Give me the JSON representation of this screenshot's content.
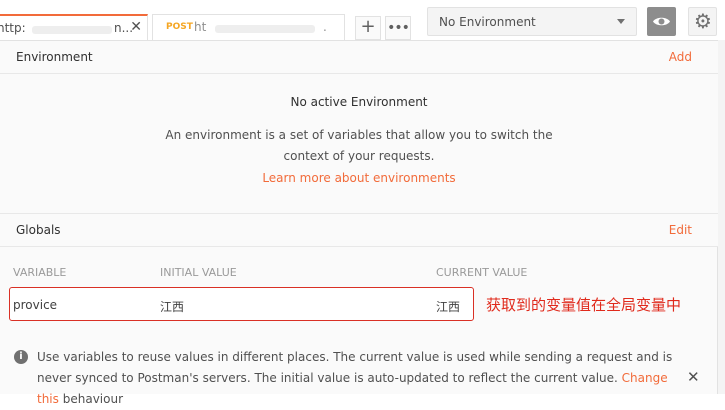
{
  "tabs": [
    {
      "method": "",
      "url": "http:",
      "suffix": "n...",
      "close": "✕"
    },
    {
      "method": "POST",
      "url": "ht",
      "suffix": "."
    }
  ],
  "toolbar": {
    "new_tab": "+",
    "more": "•••"
  },
  "environment_select": {
    "selected": "No Environment"
  },
  "environment_section": {
    "title": "Environment",
    "action": "Add",
    "empty_title": "No active Environment",
    "empty_desc_line1": "An environment is a set of variables that allow you to switch the",
    "empty_desc_line2": "context of your requests.",
    "learn_more": "Learn more about environments"
  },
  "globals_section": {
    "title": "Globals",
    "action": "Edit",
    "columns": [
      "VARIABLE",
      "INITIAL VALUE",
      "CURRENT VALUE"
    ],
    "rows": [
      {
        "variable": "provice",
        "initial_value": "江西",
        "current_value": "江西"
      }
    ]
  },
  "annotation": "获取到的变量值在全局变量中",
  "info": {
    "text_part1": "Use variables to reuse values in different places. The current value is used while sending a request and is never synced to Postman's servers. The initial value is auto-updated to reflect the current value.",
    "link": "Change this",
    "text_part2": "behaviour",
    "close": "✕"
  },
  "colors": {
    "accent": "#f26b3a",
    "annotation_red": "#e02a1c"
  }
}
